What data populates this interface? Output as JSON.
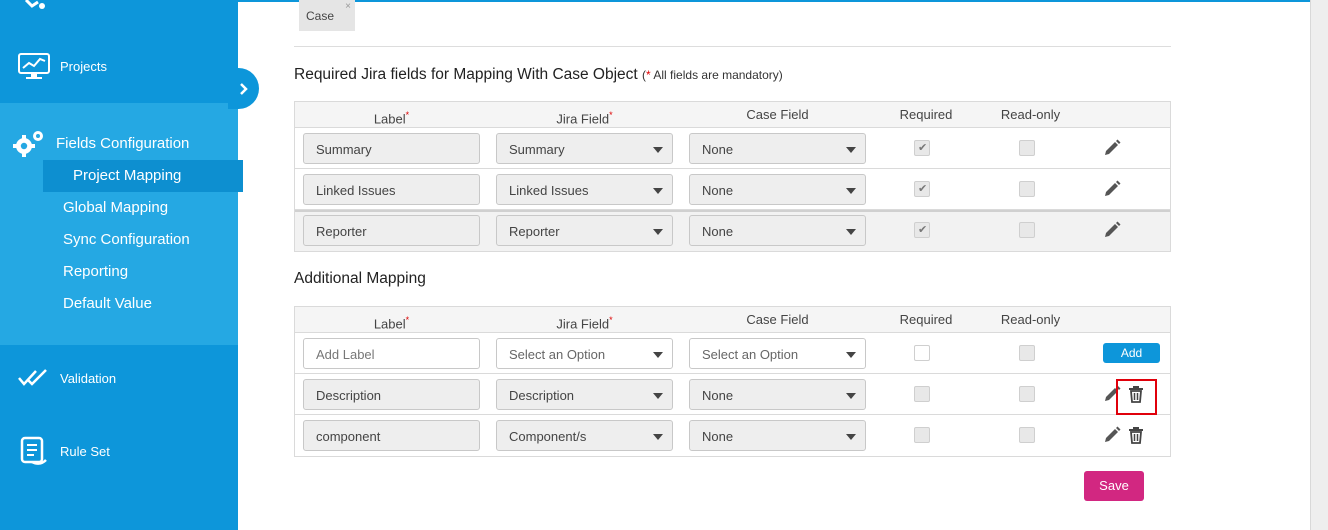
{
  "sidebar": {
    "projects_label": "Projects",
    "fields_config_label": "Fields Configuration",
    "sub_items": [
      {
        "label": "Project Mapping"
      },
      {
        "label": "Global Mapping"
      },
      {
        "label": "Sync Configuration"
      },
      {
        "label": "Reporting"
      },
      {
        "label": "Default Value"
      }
    ],
    "validation_label": "Validation",
    "rule_set_label": "Rule Set"
  },
  "object_tag": {
    "label": "Case",
    "close": "×"
  },
  "required_section": {
    "title": "Required Jira fields for Mapping With Case Object",
    "note_star": "*",
    "note": "All fields are mandatory)",
    "note_open": "(",
    "headers": {
      "label": "Label",
      "jira_field": "Jira Field",
      "case_field": "Case Field",
      "required": "Required",
      "read_only": "Read-only"
    },
    "rows": [
      {
        "label": "Summary",
        "jira_field": "Summary",
        "case_field": "None",
        "required": true,
        "read_only": false
      },
      {
        "label": "Linked Issues",
        "jira_field": "Linked Issues",
        "case_field": "None",
        "required": true,
        "read_only": false
      },
      {
        "label": "Reporter",
        "jira_field": "Reporter",
        "case_field": "None",
        "required": true,
        "read_only": false
      }
    ]
  },
  "additional_section": {
    "title": "Additional Mapping",
    "headers": {
      "label": "Label",
      "jira_field": "Jira Field",
      "case_field": "Case Field",
      "required": "Required",
      "read_only": "Read-only"
    },
    "new_row": {
      "label_placeholder": "Add Label",
      "jira_placeholder": "Select an Option",
      "case_placeholder": "Select an Option",
      "add_label": "Add"
    },
    "rows": [
      {
        "label": "Description",
        "jira_field": "Description",
        "case_field": "None"
      },
      {
        "label": "component",
        "jira_field": "Component/s",
        "case_field": "None"
      }
    ]
  },
  "save_label": "Save",
  "colors": {
    "sidebar": "#0d96da",
    "sidebar_light": "#25a8e3",
    "save": "#d22781",
    "add": "#0d96da",
    "highlight": "#e0000b"
  }
}
